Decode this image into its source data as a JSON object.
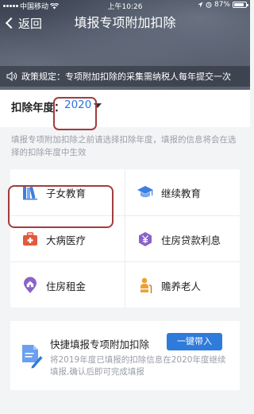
{
  "status_bar": {
    "carrier": "中国移动",
    "time": "上午10:26",
    "battery": "87%"
  },
  "nav": {
    "back_label": "返回",
    "title": "填报专项附加扣除"
  },
  "notice": {
    "text": "政策规定：专项附加扣除的采集需纳税人每年提交一次"
  },
  "year": {
    "label": "扣除年度：",
    "value": "2020"
  },
  "hint": "填报专项附加扣除之前请选择扣除年度，填报的信息将会在选择的扣除年度中生效",
  "categories": [
    {
      "label": "子女教育",
      "icon": "books-icon",
      "color": "#3d7fe0"
    },
    {
      "label": "继续教育",
      "icon": "graduation-cap-icon",
      "color": "#3d7fe0"
    },
    {
      "label": "大病医疗",
      "icon": "medical-kit-icon",
      "color": "#e05a3d"
    },
    {
      "label": "住房贷款利息",
      "icon": "yuan-coin-icon",
      "color": "#8a63c8"
    },
    {
      "label": "住房租金",
      "icon": "house-pin-icon",
      "color": "#8a63c8"
    },
    {
      "label": "赡养老人",
      "icon": "elderly-person-icon",
      "color": "#f0a030"
    }
  ],
  "quick_fill": {
    "title": "快捷填报专项附加扣除",
    "button_label": "一键带入",
    "description": "将2019年度已填报的扣除信息在2020年度继续填报,确认后即可完成填报"
  }
}
